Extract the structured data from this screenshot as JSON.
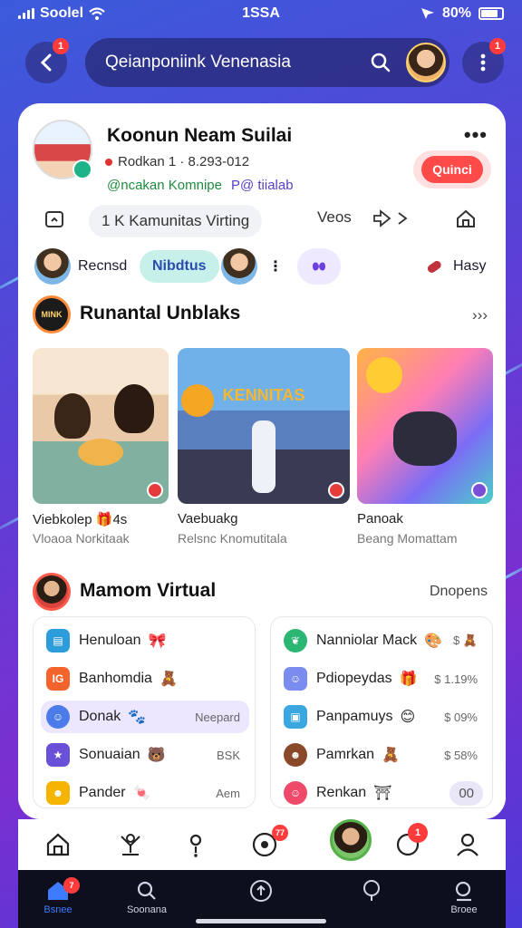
{
  "status_bar": {
    "carrier": "Soolel",
    "time": "1SSA",
    "battery": "80%"
  },
  "header": {
    "back_badge": "1",
    "search_text": "Qeianponiink Venenasia",
    "menu_badge": "1"
  },
  "profile": {
    "name": "Koonun Neam Suilai",
    "meta": "Rodkan 1 · 8.293-012",
    "tagline_1": "@ncakan Komnipe",
    "tagline_2": "P@ tiialab",
    "join_label": "Quinci"
  },
  "nav": {
    "pill_label": "1 K Kamunitas Virting",
    "item_videos": "Veos"
  },
  "chips": {
    "recent": "Recnsd",
    "active": "Nibdtus",
    "easy": "Hasy"
  },
  "section_1": {
    "logo_text": "MINK",
    "title": "Runantal Unblaks",
    "action": "›››",
    "cards": [
      {
        "line1": "Viebkolep 🎁4s",
        "line2": "Vloaoa Norkitaak"
      },
      {
        "image_text": "KENNITAS",
        "line1": "Vaebuakg",
        "line2": "Relsnc Knomutitala"
      },
      {
        "line1": "Panoak",
        "line2": "Beang Momattam"
      }
    ]
  },
  "section_2": {
    "title": "Mamom Virtual",
    "action": "Dnopens",
    "left_list": [
      {
        "label": "Henuloan",
        "deco": "🎀",
        "right": ""
      },
      {
        "label": "Banhomdia",
        "deco": "🧸",
        "right": ""
      },
      {
        "label": "Donak",
        "deco": "🐾",
        "right": "Neepard"
      },
      {
        "label": "Sonuaian",
        "deco": "🐻",
        "right": "BSK"
      },
      {
        "label": "Pander",
        "deco": "🍬",
        "right": "Aem"
      }
    ],
    "right_list": [
      {
        "label": "Nanniolar Mack",
        "deco": "🎨",
        "right": "$ 🧸"
      },
      {
        "label": "Pdiopeydas",
        "deco": "🎁",
        "right": "$ 1.19%"
      },
      {
        "label": "Panpamuys",
        "deco": "😊",
        "right": "$ 09%"
      },
      {
        "label": "Pamrkan",
        "deco": "🧸",
        "right": "$ 58%"
      },
      {
        "label": "Renkan",
        "deco": "⛩",
        "right": "00"
      }
    ]
  },
  "icon_row": {
    "badge_4": "77",
    "badge_6": "1"
  },
  "tab_bar": {
    "tab_home": "Bsnee",
    "tab_search": "Soonana",
    "tab_profile": "Broee",
    "home_badge": "7"
  },
  "colors": {
    "accent": "#3f7bff",
    "join": "#ff4a4a",
    "active_chip": "#c8f0ea",
    "highlight_row": "#ece7ff"
  }
}
